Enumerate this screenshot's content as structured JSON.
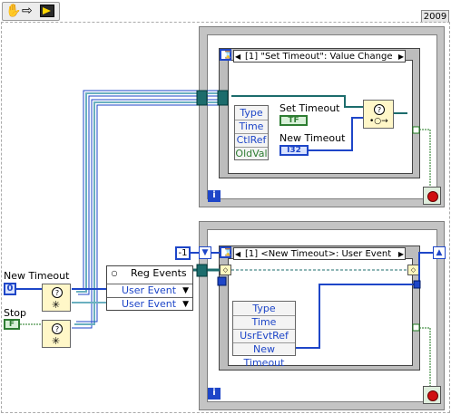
{
  "toolbar": {
    "run_hint": "hand",
    "arrow": "arrow",
    "run": "run-arrow"
  },
  "year": "2009",
  "top_loop": {
    "event_selector": "[1] \"Set Timeout\": Value Change",
    "event_data": [
      "Type",
      "Time",
      "CtlRef",
      "OldVal"
    ],
    "set_timeout_label": "Set Timeout",
    "set_timeout_terminal": "TF",
    "new_timeout_label": "New Timeout",
    "new_timeout_terminal": "I32",
    "iteration_label": "i"
  },
  "bottom_loop": {
    "constant": "-1",
    "event_selector": "[1] <New Timeout>: User Event",
    "event_data": [
      "Type",
      "Time",
      "UsrEvtRef",
      "New Timeout"
    ],
    "iteration_label": "i"
  },
  "reg_events": {
    "title": "Reg Events",
    "rows": [
      "User Event",
      "User Event"
    ]
  },
  "new_timeout_control": {
    "label": "New Timeout",
    "value": "0"
  },
  "stop_control": {
    "label": "Stop",
    "value": "F"
  },
  "colors": {
    "wire_blue": "#1e46c8",
    "wire_green": "#1f7a1f",
    "frame": "#c4c4c4"
  }
}
